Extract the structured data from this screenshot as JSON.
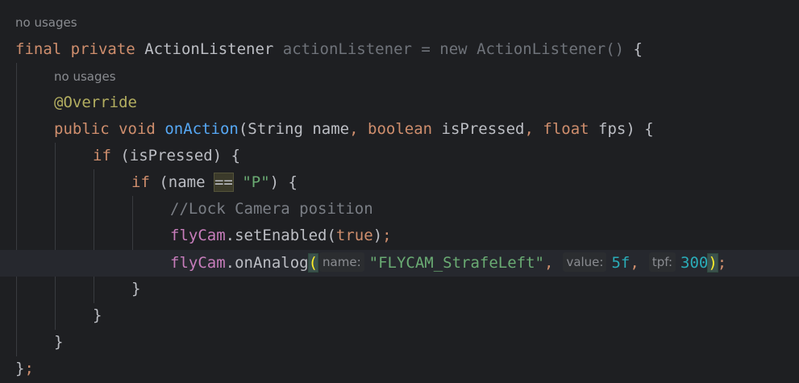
{
  "hints": {
    "usages_outer": "no usages",
    "usages_inner": "no usages"
  },
  "code": {
    "l1": {
      "final": "final",
      "private": "private",
      "type": "ActionListener",
      "var": "actionListener",
      "eq": " = ",
      "new": "new",
      "ctor": "ActionListener()",
      "brace": " {"
    },
    "l2": {
      "annotation": "@Override"
    },
    "l3": {
      "public": "public",
      "void": "void",
      "method": "onAction",
      "open": "(",
      "t1": "String",
      "p1": " name",
      "c1": ", ",
      "t2": "boolean",
      "p2": " isPressed",
      "c2": ", ",
      "t3": "float",
      "p3": " fps",
      "close": ") {"
    },
    "l4": {
      "if": "if",
      "cond": " (isPressed) {"
    },
    "l5": {
      "if": "if",
      "pre": " (name ",
      "op": "==",
      "sp": " ",
      "str": "\"P\"",
      "post": ") {"
    },
    "l6": {
      "comment": "//Lock Camera position"
    },
    "l7": {
      "obj": "flyCam",
      "call": ".setEnabled(",
      "lit": "true",
      "end": ")",
      "semi": ";"
    },
    "l8": {
      "obj": "flyCam",
      "call": ".onAnalog",
      "open": "(",
      "hint1": "name:",
      "arg1": "\"FLYCAM_StrafeLeft\"",
      "c1": ",",
      "hint2": "value:",
      "arg2": "5f",
      "c2": ",",
      "hint3": "tpf:",
      "arg3": "300",
      "close": ")",
      "semi": ";"
    },
    "l9": {
      "brace": "}"
    },
    "l10": {
      "brace": "}"
    },
    "l11": {
      "brace": "}"
    },
    "l12": {
      "brace": "}",
      "semi": ";"
    }
  }
}
